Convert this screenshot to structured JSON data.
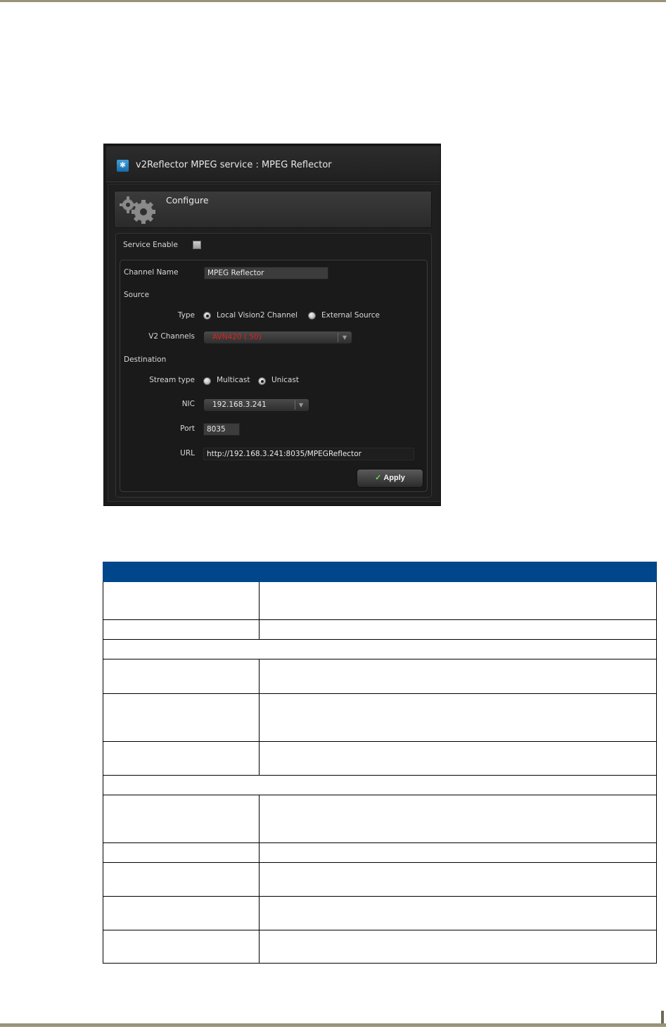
{
  "window": {
    "title": "v2Reflector MPEG service : MPEG Reflector"
  },
  "configure": {
    "label": "Configure"
  },
  "form": {
    "service_enable_label": "Service Enable",
    "channel_name_label": "Channel Name",
    "channel_name_value": "MPEG Reflector",
    "source_heading": "Source",
    "type_label": "Type",
    "type_options": [
      "Local Vision2 Channel",
      "External Source"
    ],
    "type_selected": "Local Vision2 Channel",
    "v2_channels_label": "V2 Channels",
    "v2_channels_value": "AVN420 (.50)",
    "destination_heading": "Destination",
    "stream_type_label": "Stream type",
    "stream_type_options": [
      "Multicast",
      "Unicast"
    ],
    "stream_type_selected": "Unicast",
    "nic_label": "NIC",
    "nic_value": "192.168.3.241",
    "port_label": "Port",
    "port_value": "8035",
    "url_label": "URL",
    "url_value": "http://192.168.3.241:8035/MPEGReflector",
    "apply_label": "Apply"
  },
  "colors": {
    "table_header": "#00468b",
    "page_rule": "#9a9377",
    "channel_text": "#e02020",
    "apply_check": "#6fd24a"
  }
}
